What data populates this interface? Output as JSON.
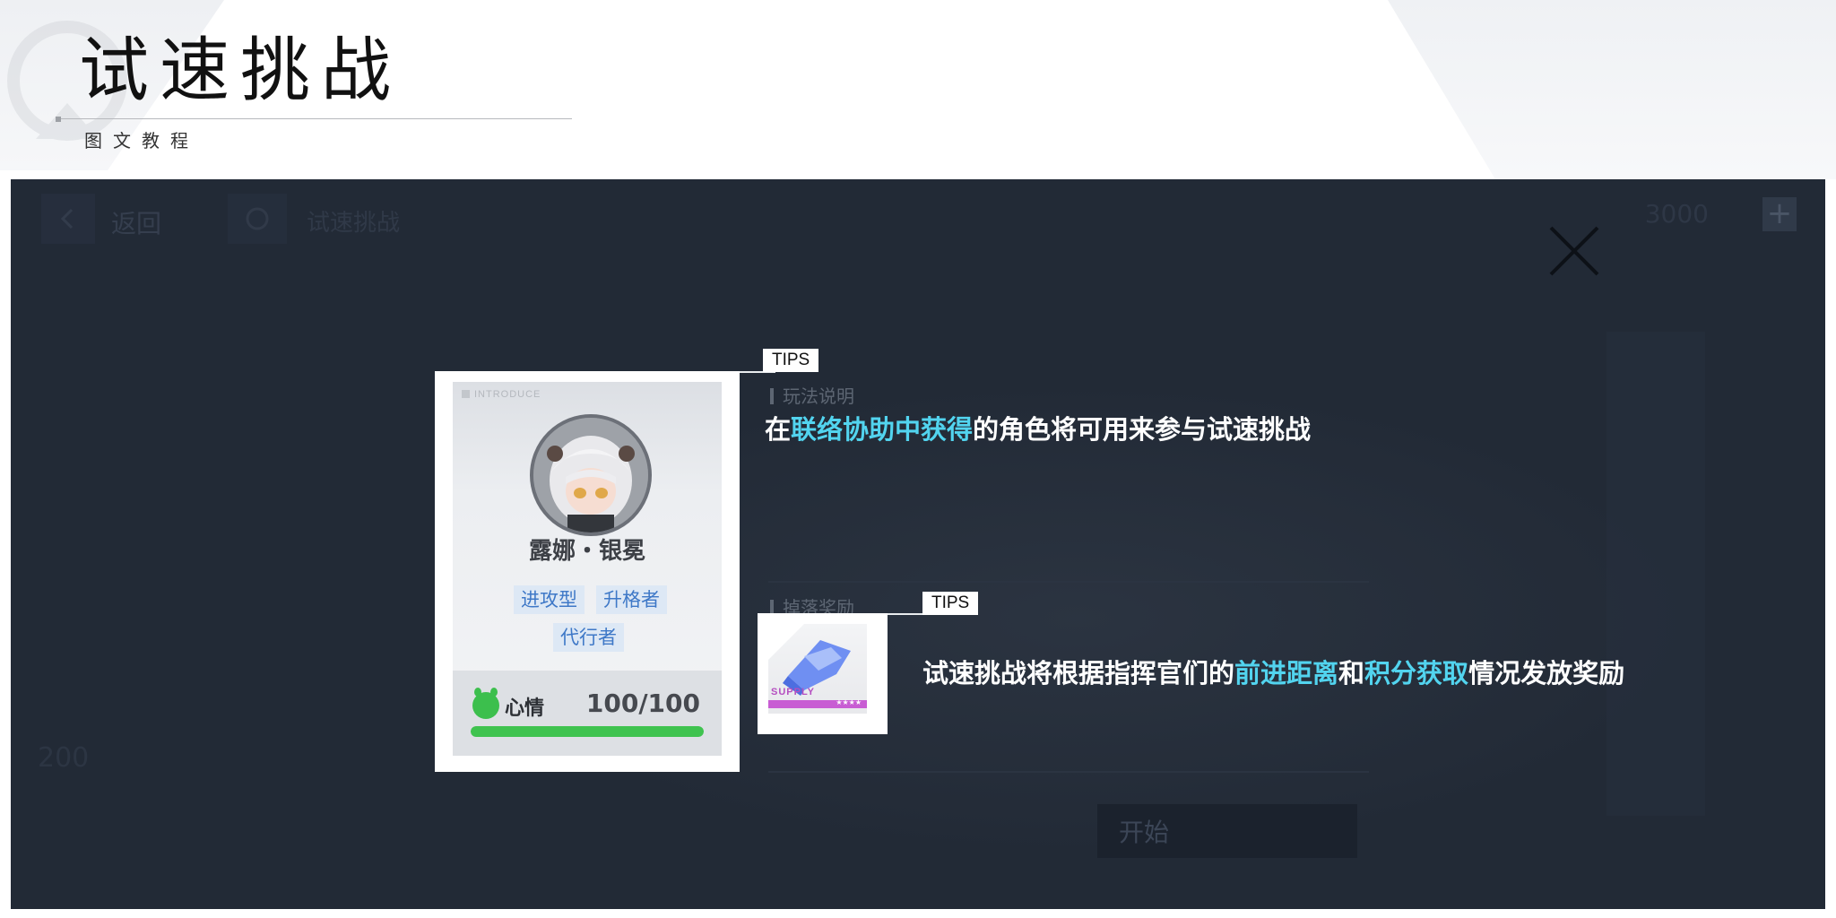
{
  "header": {
    "title": "试速挑战",
    "subtitle": "图文教程"
  },
  "game": {
    "topbar": {
      "back_label": "返回",
      "home_label": "试速挑战",
      "currency": "3000"
    },
    "dim_number": "200",
    "start_button": "开始",
    "section_rules": "玩法说明",
    "section_rewards": "掉落奖励",
    "introduce_label": "INTRODUCE",
    "character": {
      "name": "露娜・银冕",
      "tags": [
        "进攻型",
        "升格者",
        "代行者"
      ],
      "mood_label": "心情",
      "mood_value": "100/100",
      "mood_fraction": 1.0
    },
    "item": {
      "supply_label": "SUPPLY",
      "stars": "★★★★"
    },
    "tips": [
      {
        "tag": "TIPS",
        "parts": [
          {
            "text": "在",
            "highlight": false
          },
          {
            "text": "联络协助中获得",
            "highlight": true
          },
          {
            "text": "的角色将可用来参与试速挑战",
            "highlight": false
          }
        ]
      },
      {
        "tag": "TIPS",
        "parts": [
          {
            "text": "试速挑战将根据指挥官们的",
            "highlight": false
          },
          {
            "text": "前进距离",
            "highlight": true
          },
          {
            "text": "和",
            "highlight": false
          },
          {
            "text": "积分获取",
            "highlight": true
          },
          {
            "text": "情况发放奖励",
            "highlight": false
          }
        ]
      }
    ],
    "colors": {
      "highlight": "#52d4ef",
      "panel_bg": "#222a36",
      "tag_blue": "#3e78c7",
      "mood_green": "#3fc34f"
    }
  }
}
